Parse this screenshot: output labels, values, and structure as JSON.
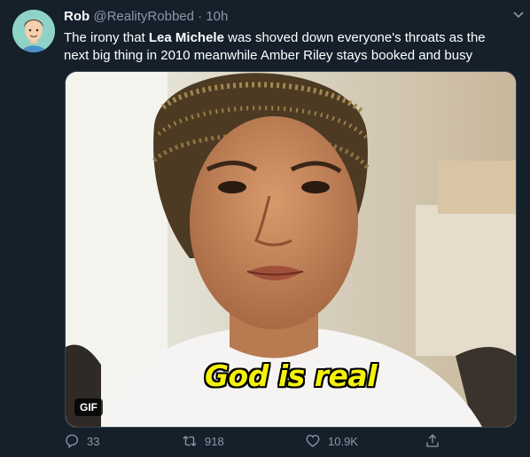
{
  "tweet": {
    "author_name": "Rob",
    "handle": "@RealityRobbed",
    "separator": "·",
    "time": "10h",
    "text_before": "The irony that ",
    "text_bold": "Lea Michele",
    "text_after": " was shoved down everyone's throats as the next big thing in 2010 meanwhile Amber Riley stays booked and busy"
  },
  "media": {
    "caption": "God is real",
    "badge": "GIF"
  },
  "actions": {
    "replies": "33",
    "retweets": "918",
    "likes": "10.9K"
  },
  "icons": {
    "reply": "reply-icon",
    "retweet": "retweet-icon",
    "like": "heart-icon",
    "share": "share-icon",
    "menu": "chevron-down-icon"
  },
  "colors": {
    "background": "#15202b",
    "muted": "#8899a6",
    "caption": "#f4f10a"
  }
}
